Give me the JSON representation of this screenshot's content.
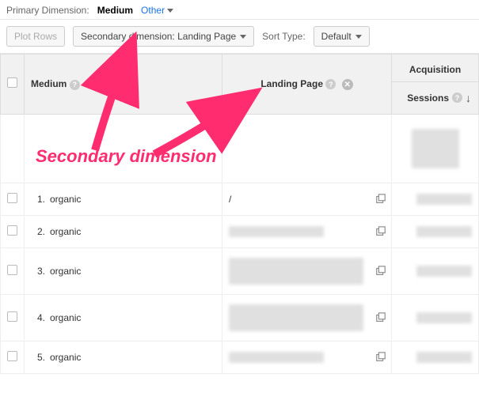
{
  "primary_dimension": {
    "label": "Primary Dimension:",
    "active": "Medium",
    "other": "Other"
  },
  "toolbar": {
    "plot_rows": "Plot Rows",
    "secondary_dim": "Secondary dimension: Landing Page",
    "sort_type_label": "Sort Type:",
    "sort_type_value": "Default"
  },
  "columns": {
    "medium": "Medium",
    "landing": "Landing Page",
    "acquisition": "Acquisition",
    "sessions": "Sessions"
  },
  "rows": [
    {
      "n": "1.",
      "medium": "organic",
      "landing": "/",
      "popout": true,
      "landing_redacted": false,
      "tall": false
    },
    {
      "n": "2.",
      "medium": "organic",
      "landing": "",
      "popout": true,
      "landing_redacted": true,
      "tall": false
    },
    {
      "n": "3.",
      "medium": "organic",
      "landing": "",
      "popout": true,
      "landing_redacted": true,
      "tall": true
    },
    {
      "n": "4.",
      "medium": "organic",
      "landing": "",
      "popout": true,
      "landing_redacted": true,
      "tall": true
    },
    {
      "n": "5.",
      "medium": "organic",
      "landing": "",
      "popout": true,
      "landing_redacted": true,
      "tall": false
    }
  ],
  "annotation": "Secondary dimension"
}
